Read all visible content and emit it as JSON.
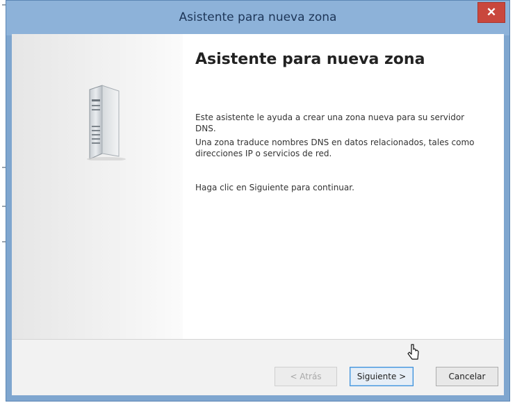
{
  "window": {
    "title": "Asistente para nueva zona",
    "close_symbol": "✕"
  },
  "wizard": {
    "heading": "Asistente para nueva zona",
    "paragraphs": [
      "Este asistente le ayuda a crear una zona nueva para su servidor DNS.",
      "Una zona traduce nombres DNS en datos relacionados, tales como direcciones IP o servicios de red.",
      "Haga clic en Siguiente para continuar."
    ],
    "icon": "server-tower-icon"
  },
  "buttons": {
    "back": "< Atrás",
    "next": "Siguiente >",
    "cancel": "Cancelar"
  },
  "colors": {
    "titlebar": "#8db2d9",
    "close": "#c9473d",
    "default_button_border": "#3b8fd9"
  }
}
